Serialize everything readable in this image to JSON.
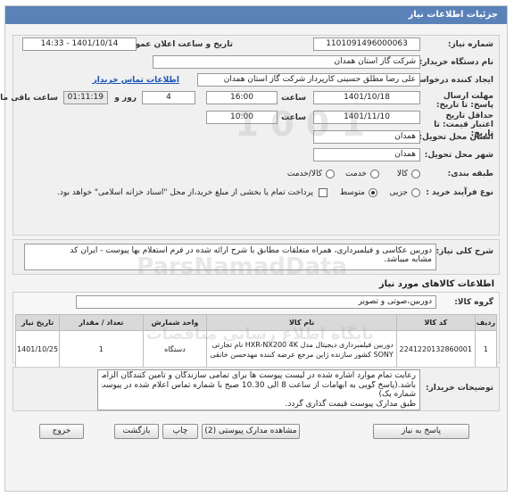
{
  "page_title": "جزئیات اطلاعات نیاز",
  "fields": {
    "need_number": {
      "label": "شماره نیاز:",
      "value": "1101091496000063"
    },
    "announce_datetime": {
      "label": "تاریخ و ساعت اعلان عمومی:",
      "value": "1401/10/14 - 14:33"
    },
    "buyer_org": {
      "label": "نام دستگاه خریدار:",
      "value": "شرکت گاز استان همدان"
    },
    "creator": {
      "label": "ایجاد کننده درخواست:",
      "value": "علی رضا مطلق حسینی کارپرداز شرکت گاز استان همدان",
      "link": "اطلاعات تماس خریدار"
    },
    "send_deadline": {
      "label": "مهلت ارسال پاسخ: تا تاریخ:",
      "date": "1401/10/18",
      "time_label": "ساعت",
      "time": "16:00",
      "days": "4",
      "days_label": "روز و",
      "remaining": "01:11:19",
      "remaining_label": "ساعت باقی مانده"
    },
    "price_validity": {
      "label": "حداقل تاریخ اعتبار قیمت: تا تاریخ:",
      "date": "1401/11/10",
      "time_label": "ساعت",
      "time": "10:00"
    },
    "delivery_province": {
      "label": "استان محل تحویل:",
      "value": "همدان"
    },
    "delivery_city": {
      "label": "شهر محل تحویل:",
      "value": "همدان"
    },
    "category": {
      "label": "طبقه بندی:",
      "options": [
        "کالا",
        "خدمت",
        "کالا/خدمت"
      ]
    },
    "purchase_process": {
      "label": "نوع فرآیند خرید :",
      "options": [
        "جزیی",
        "متوسط"
      ],
      "note": "پرداخت تمام یا بخشی از مبلغ خرید،از محل \"اسناد خزانه اسلامی\" خواهد بود."
    }
  },
  "description": {
    "label": "شرح کلی نیاز:",
    "line1": "دوربین عکاسی و فیلمبرداری، همراه متعلقات مطابق با شرح ارائه شده در فرم استعلام بها پیوست - ایران کد",
    "line2": "مشابه میباشد."
  },
  "goods_section": {
    "title": "اطلاعات کالاهای مورد نیاز",
    "group_label": "گروه کالا:",
    "group_value": "دوربین،صوتی و تصویر",
    "columns": [
      "ردیف",
      "کد کالا",
      "نام کالا",
      "واحد شمارش",
      "تعداد / مقدار",
      "تاریخ نیاز"
    ],
    "rows": [
      {
        "row": "1",
        "code": "2241220132860001",
        "name_line1": "دوربین فیلمبرداری دیجیتال مدل HXR-NX200 4K نام تجارتی",
        "name_line2": "SONY کشور سازنده ژاپن مرجع عرضه کننده مهدحسن خانقی",
        "unit": "دستگاه",
        "qty": "1",
        "date": "1401/10/25"
      }
    ]
  },
  "buyer_notes": {
    "label": "توضیحات خریدار:",
    "line1": "رعایت تمام موارد اشاره شده در لیست پیوست ها برای تمامی سازندگان و تامین کنندگان الزامی می",
    "line2": "باشد.(پاسخ گویی به ابهامات از ساعت 8 الی 10.30 صبح با شماره تماس اعلام شده در پیوست",
    "line3": "شماره یک)",
    "line4": "طبق مدارک پیوست قیمت گذاری گردد."
  },
  "buttons": {
    "reply": "پاسخ به نیاز",
    "attachments": "مشاهده مدارک پیوستی (2)",
    "print": "چاپ",
    "back": "بازگشت",
    "exit": "خروج"
  },
  "watermark": {
    "brand": "ParsNamadData",
    "sub1": "پایگاه اطلاع رسانی مناقصات",
    "sub2": "اطلاعات تجاری نمادها"
  },
  "colors": {
    "title_bar": "#5a82b8",
    "link": "#1a55b3"
  }
}
